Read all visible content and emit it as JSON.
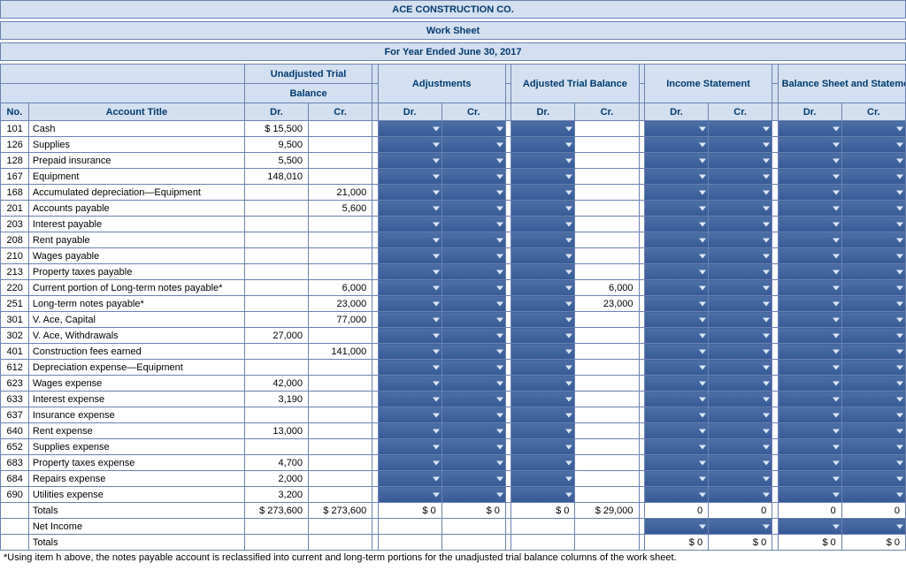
{
  "header": {
    "company": "ACE CONSTRUCTION CO.",
    "report": "Work Sheet",
    "period": "For Year Ended June 30, 2017",
    "sections": {
      "unadjusted1": "Unadjusted Trial",
      "unadjusted2": "Balance",
      "adjustments": "Adjustments",
      "adjusted": "Adjusted Trial Balance",
      "income": "Income Statement",
      "balsheet": "Balance Sheet and Statement of Owner's Equity"
    },
    "cols": {
      "no": "No.",
      "title": "Account Title",
      "dr": "Dr.",
      "cr": "Cr."
    }
  },
  "rows": [
    {
      "no": "101",
      "title": "Cash",
      "utb_dr": "$   15,500",
      "utb_cr": "",
      "atb_cr": ""
    },
    {
      "no": "126",
      "title": "Supplies",
      "utb_dr": "9,500",
      "utb_cr": "",
      "atb_cr": ""
    },
    {
      "no": "128",
      "title": "Prepaid insurance",
      "utb_dr": "5,500",
      "utb_cr": "",
      "atb_cr": ""
    },
    {
      "no": "167",
      "title": "Equipment",
      "utb_dr": "148,010",
      "utb_cr": "",
      "atb_cr": ""
    },
    {
      "no": "168",
      "title": "Accumulated depreciation—Equipment",
      "utb_dr": "",
      "utb_cr": "21,000",
      "atb_cr": ""
    },
    {
      "no": "201",
      "title": "Accounts payable",
      "utb_dr": "",
      "utb_cr": "5,600",
      "atb_cr": ""
    },
    {
      "no": "203",
      "title": "Interest payable",
      "utb_dr": "",
      "utb_cr": "",
      "atb_cr": ""
    },
    {
      "no": "208",
      "title": "Rent payable",
      "utb_dr": "",
      "utb_cr": "",
      "atb_cr": ""
    },
    {
      "no": "210",
      "title": "Wages payable",
      "utb_dr": "",
      "utb_cr": "",
      "atb_cr": ""
    },
    {
      "no": "213",
      "title": "Property taxes payable",
      "utb_dr": "",
      "utb_cr": "",
      "atb_cr": ""
    },
    {
      "no": "220",
      "title": "Current portion of Long-term notes payable*",
      "utb_dr": "",
      "utb_cr": "6,000",
      "atb_cr": "6,000"
    },
    {
      "no": "251",
      "title": "Long-term notes payable*",
      "utb_dr": "",
      "utb_cr": "23,000",
      "atb_cr": "23,000"
    },
    {
      "no": "301",
      "title": "V. Ace, Capital",
      "utb_dr": "",
      "utb_cr": "77,000",
      "atb_cr": ""
    },
    {
      "no": "302",
      "title": "V. Ace, Withdrawals",
      "utb_dr": "27,000",
      "utb_cr": "",
      "atb_cr": ""
    },
    {
      "no": "401",
      "title": "Construction fees earned",
      "utb_dr": "",
      "utb_cr": "141,000",
      "atb_cr": ""
    },
    {
      "no": "612",
      "title": "Depreciation expense—Equipment",
      "utb_dr": "",
      "utb_cr": "",
      "atb_cr": ""
    },
    {
      "no": "623",
      "title": "Wages expense",
      "utb_dr": "42,000",
      "utb_cr": "",
      "atb_cr": ""
    },
    {
      "no": "633",
      "title": "Interest expense",
      "utb_dr": "3,190",
      "utb_cr": "",
      "atb_cr": ""
    },
    {
      "no": "637",
      "title": "Insurance expense",
      "utb_dr": "",
      "utb_cr": "",
      "atb_cr": ""
    },
    {
      "no": "640",
      "title": "Rent expense",
      "utb_dr": "13,000",
      "utb_cr": "",
      "atb_cr": ""
    },
    {
      "no": "652",
      "title": "Supplies expense",
      "utb_dr": "",
      "utb_cr": "",
      "atb_cr": ""
    },
    {
      "no": "683",
      "title": "Property taxes expense",
      "utb_dr": "4,700",
      "utb_cr": "",
      "atb_cr": ""
    },
    {
      "no": "684",
      "title": "Repairs expense",
      "utb_dr": "2,000",
      "utb_cr": "",
      "atb_cr": ""
    },
    {
      "no": "690",
      "title": "Utilities expense",
      "utb_dr": "3,200",
      "utb_cr": "",
      "atb_cr": ""
    }
  ],
  "totals1": {
    "label": "Totals",
    "utb_dr": "$ 273,600",
    "utb_cr": "$ 273,600",
    "adj_dr": "$               0",
    "adj_cr": "$               0",
    "atb_dr": "$               0",
    "atb_cr": "$        29,000",
    "is_dr": "0",
    "is_cr": "0",
    "bs_dr": "0",
    "bs_cr": "0"
  },
  "netincome": {
    "label": "Net Income"
  },
  "totals2": {
    "label": "Totals",
    "is_dr": "$               0",
    "is_cr": "$               0",
    "bs_dr": "$               0",
    "bs_cr": "$               0"
  },
  "footnote": "*Using item h above, the notes payable account is reclassified into current and long-term portions for the unadjusted trial balance columns of the work sheet."
}
